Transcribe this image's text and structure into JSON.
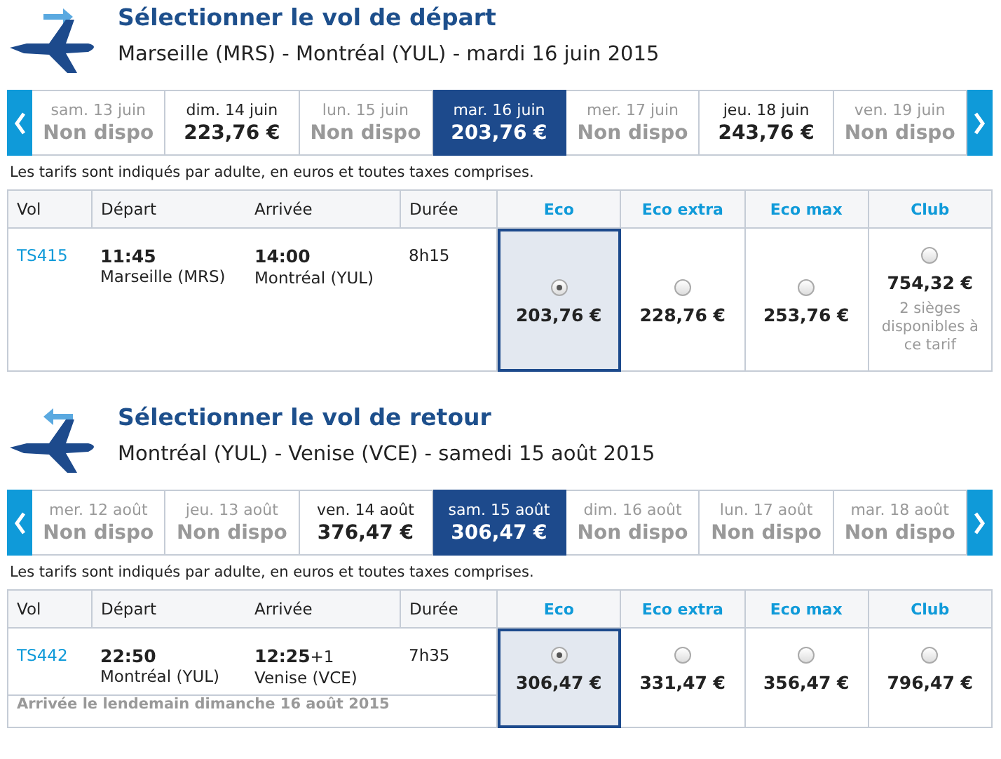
{
  "sections": [
    {
      "kind": "outbound",
      "title": "Sélectionner le vol de départ",
      "route": "Marseille (MRS) - Montréal (YUL) - mardi 16 juin 2015",
      "dates": [
        {
          "label": "sam. 13 juin",
          "price": "Non dispo",
          "available": false,
          "selected": false
        },
        {
          "label": "dim. 14 juin",
          "price": "223,76 €",
          "available": true,
          "selected": false
        },
        {
          "label": "lun. 15 juin",
          "price": "Non dispo",
          "available": false,
          "selected": false
        },
        {
          "label": "mar. 16 juin",
          "price": "203,76 €",
          "available": true,
          "selected": true
        },
        {
          "label": "mer. 17 juin",
          "price": "Non dispo",
          "available": false,
          "selected": false
        },
        {
          "label": "jeu. 18 juin",
          "price": "243,76 €",
          "available": true,
          "selected": false
        },
        {
          "label": "ven. 19 juin",
          "price": "Non dispo",
          "available": false,
          "selected": false
        }
      ],
      "note": "Les tarifs sont indiqués par adulte, en euros et toutes taxes comprises.",
      "columns": [
        "Vol",
        "Départ",
        "Arrivée",
        "Durée"
      ],
      "fare_columns": [
        "Eco",
        "Eco extra",
        "Eco max",
        "Club"
      ],
      "flight": {
        "number": "TS415",
        "departure_time": "11:45",
        "departure_airport": "Marseille (MRS)",
        "arrival_time": "14:00",
        "arrival_airport": "Montréal (YUL)",
        "duration": "8h15",
        "fares": [
          {
            "price": "203,76 €",
            "selected": true
          },
          {
            "price": "228,76 €",
            "selected": false
          },
          {
            "price": "253,76 €",
            "selected": false
          },
          {
            "price": "754,32 €",
            "selected": false,
            "note": "2 sièges disponibles à ce tarif"
          }
        ]
      }
    },
    {
      "kind": "return",
      "title": "Sélectionner le vol de retour",
      "route": "Montréal (YUL) - Venise (VCE) - samedi 15 août 2015",
      "dates": [
        {
          "label": "mer. 12 août",
          "price": "Non dispo",
          "available": false,
          "selected": false
        },
        {
          "label": "jeu. 13 août",
          "price": "Non dispo",
          "available": false,
          "selected": false
        },
        {
          "label": "ven. 14 août",
          "price": "376,47 €",
          "available": true,
          "selected": false
        },
        {
          "label": "sam. 15 août",
          "price": "306,47 €",
          "available": true,
          "selected": true
        },
        {
          "label": "dim. 16 août",
          "price": "Non dispo",
          "available": false,
          "selected": false
        },
        {
          "label": "lun. 17 août",
          "price": "Non dispo",
          "available": false,
          "selected": false
        },
        {
          "label": "mar. 18 août",
          "price": "Non dispo",
          "available": false,
          "selected": false
        }
      ],
      "note": "Les tarifs sont indiqués par adulte, en euros et toutes taxes comprises.",
      "columns": [
        "Vol",
        "Départ",
        "Arrivée",
        "Durée"
      ],
      "fare_columns": [
        "Eco",
        "Eco extra",
        "Eco max",
        "Club"
      ],
      "flight": {
        "number": "TS442",
        "departure_time": "22:50",
        "departure_airport": "Montréal (YUL)",
        "arrival_time": "12:25",
        "arrival_offset": "+1",
        "arrival_airport": "Venise (VCE)",
        "duration": "7h35",
        "arrival_note": "Arrivée le lendemain dimanche 16 août 2015",
        "fares": [
          {
            "price": "306,47 €",
            "selected": true
          },
          {
            "price": "331,47 €",
            "selected": false
          },
          {
            "price": "356,47 €",
            "selected": false
          },
          {
            "price": "796,47 €",
            "selected": false
          }
        ]
      }
    }
  ]
}
